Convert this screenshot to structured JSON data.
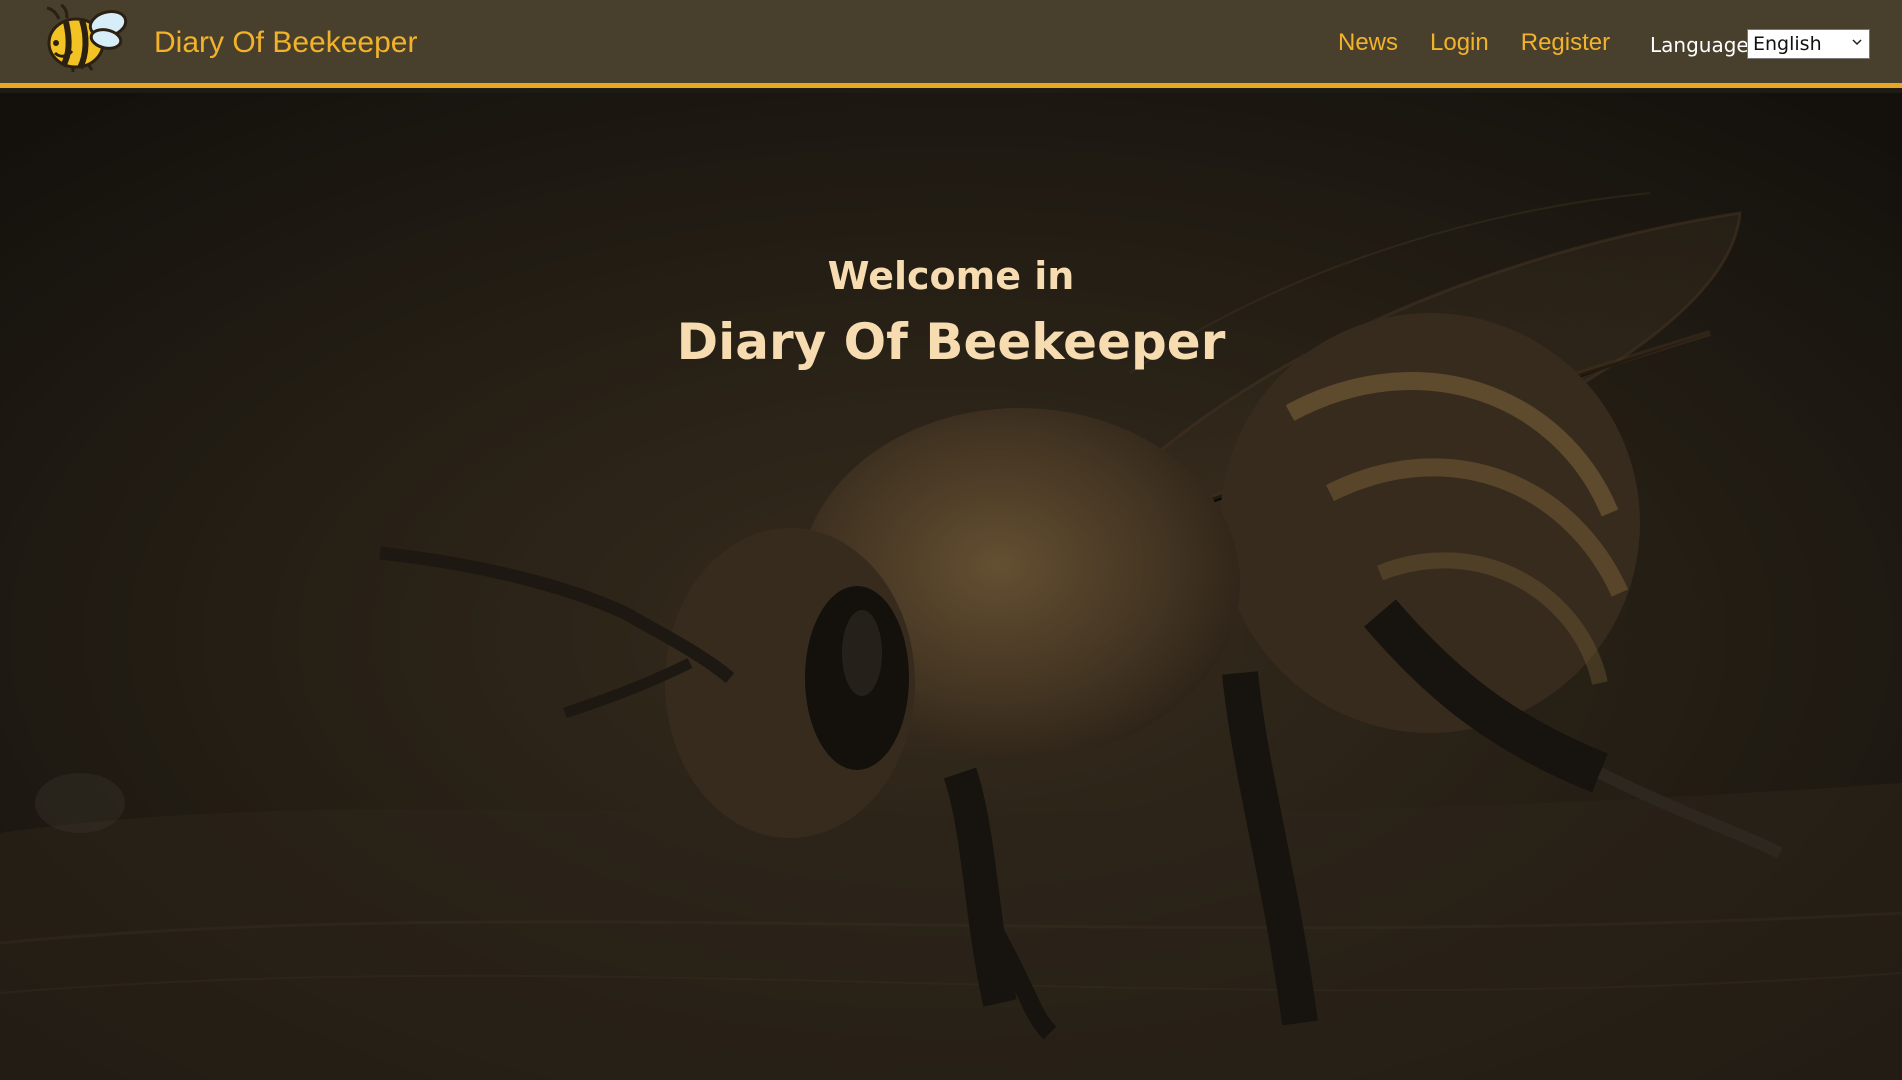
{
  "navbar": {
    "brand": "Diary Of Beekeeper",
    "links": [
      "News",
      "Login",
      "Register"
    ],
    "language_label": "Language",
    "language_selected": "English"
  },
  "hero": {
    "welcome": "Welcome in",
    "title": "Diary Of Beekeeper"
  },
  "colors": {
    "navbar_bg": "#48402d",
    "accent": "#e8a723",
    "link": "#f2b22a",
    "hero_text": "#f6dcb0"
  },
  "icons": {
    "logo": "bee-logo-icon",
    "select": "chevron-down-icon"
  }
}
